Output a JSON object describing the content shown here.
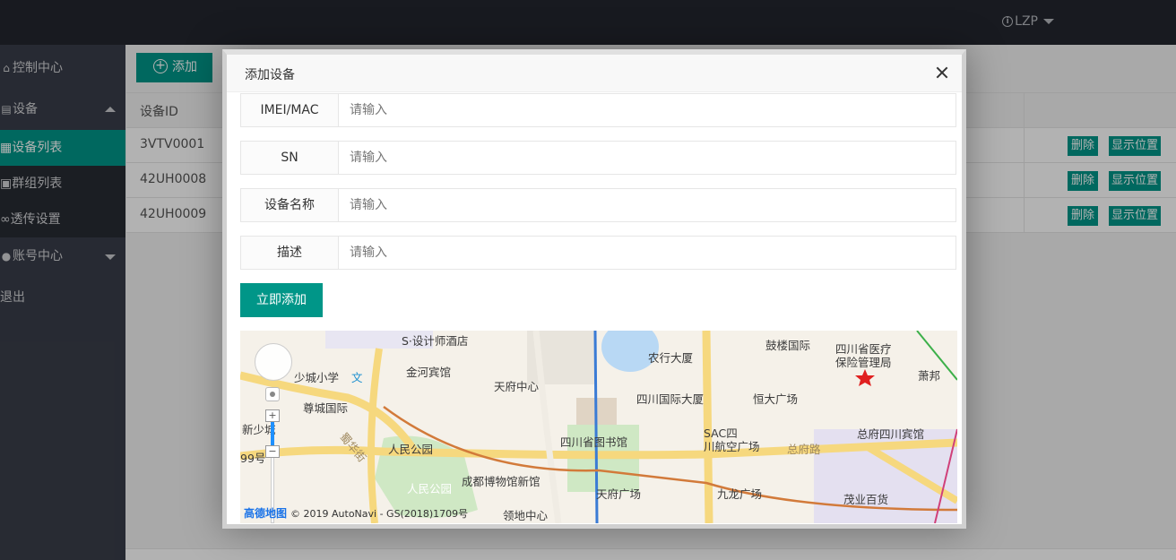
{
  "header": {
    "user": "LZP"
  },
  "sidebar": {
    "items": [
      {
        "label": "控制中心"
      },
      {
        "label": "设备"
      },
      {
        "label": "账号中心"
      },
      {
        "label": "退出"
      }
    ],
    "submenu": [
      {
        "label": "设备列表"
      },
      {
        "label": "群组列表"
      },
      {
        "label": "透传设置"
      }
    ]
  },
  "toolbar": {
    "add_label": "添加"
  },
  "table": {
    "headers": [
      "设备ID"
    ],
    "rows": [
      {
        "id": "3VTV0001",
        "delete": "删除",
        "location": "显示位置"
      },
      {
        "id": "42UH0008",
        "delete": "删除",
        "location": "显示位置"
      },
      {
        "id": "42UH0009",
        "delete": "删除",
        "location": "显示位置"
      }
    ]
  },
  "modal": {
    "title": "添加设备",
    "fields": [
      {
        "label": "IMEI/MAC",
        "placeholder": "请输入"
      },
      {
        "label": "SN",
        "placeholder": "请输入"
      },
      {
        "label": "设备名称",
        "placeholder": "请输入"
      },
      {
        "label": "描述",
        "placeholder": "请输入"
      }
    ],
    "submit_label": "立即添加"
  },
  "map": {
    "labels": [
      "S·设计师酒店",
      "金河宾馆",
      "少城小学",
      "文",
      "天府中心",
      "农行大厦",
      "鼓楼国际",
      "四川省医疗",
      "保险管理局",
      "萧邦",
      "四川国际大厦",
      "恒大广场",
      "尊城国际",
      "新少城",
      "人民公园",
      "四川省图书馆",
      "SAC四",
      "川航空广场",
      "总府路",
      "总府四川宾馆",
      "成都博物馆新馆",
      "人民公园",
      "天府广场",
      "九龙广场",
      "茂业百货",
      "领地中心",
      "蜀华街",
      "99号"
    ],
    "credit_logo": "高德地图",
    "credit_text": "© 2019 AutoNavi - GS(2018)1709号"
  },
  "colors": {
    "accent": "#009688",
    "header_bg": "#23262e",
    "sidebar_bg": "#393d49"
  }
}
